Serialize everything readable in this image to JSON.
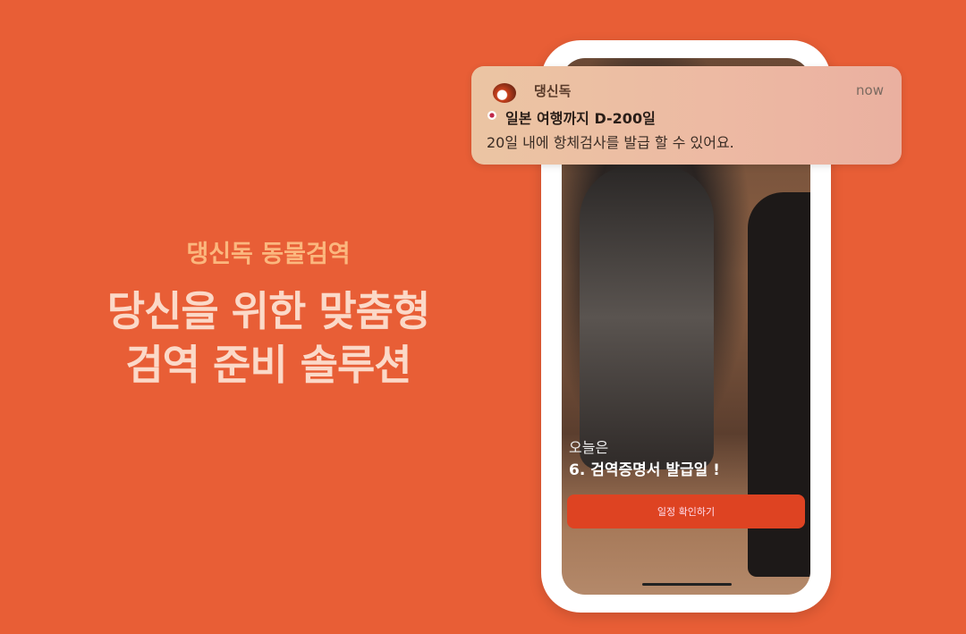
{
  "promo": {
    "subtitle": "댕신독 동물검역",
    "headline_line1": "당신을 위한 맞춤형",
    "headline_line2": "검역 준비 솔루션"
  },
  "notification": {
    "app_name": "댕신독",
    "time": "now",
    "flag_icon": "japan-flag-icon",
    "title": "일본 여행까지 D-200일",
    "body": "20일 내에 항체검사를 발급 할 수 있어요."
  },
  "screen": {
    "today_label": "오늘은",
    "event": "6. 검역증명서 발급일 !",
    "button_label": "일정 확인하기"
  },
  "colors": {
    "background": "#E85E36",
    "button": "#DE4322",
    "subtitle": "#FBB77E",
    "headline": "#FBD9C8"
  }
}
